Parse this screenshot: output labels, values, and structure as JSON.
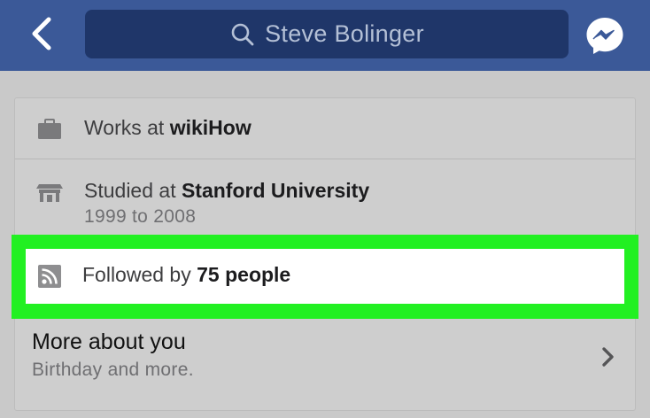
{
  "colors": {
    "navbar": "#3b5998",
    "search_bg": "#1f3669",
    "highlight": "#22f022",
    "background": "#c9c9c9"
  },
  "navbar": {
    "back_icon": "chevron-left-icon",
    "search_icon": "search-icon",
    "search_text": "Steve Bolinger",
    "messenger_icon": "messenger-icon"
  },
  "about": {
    "work": {
      "icon": "briefcase-icon",
      "prefix": "Works at ",
      "value": "wikiHow"
    },
    "education": {
      "icon": "school-icon",
      "prefix": "Studied at ",
      "value": "Stanford University",
      "years": "1999 to 2008"
    },
    "followers": {
      "icon": "rss-feed-icon",
      "prefix": "Followed by ",
      "value": "75 people"
    },
    "more": {
      "title": "More about you",
      "subtitle": "Birthday and more.",
      "chevron_icon": "chevron-right-icon"
    }
  }
}
